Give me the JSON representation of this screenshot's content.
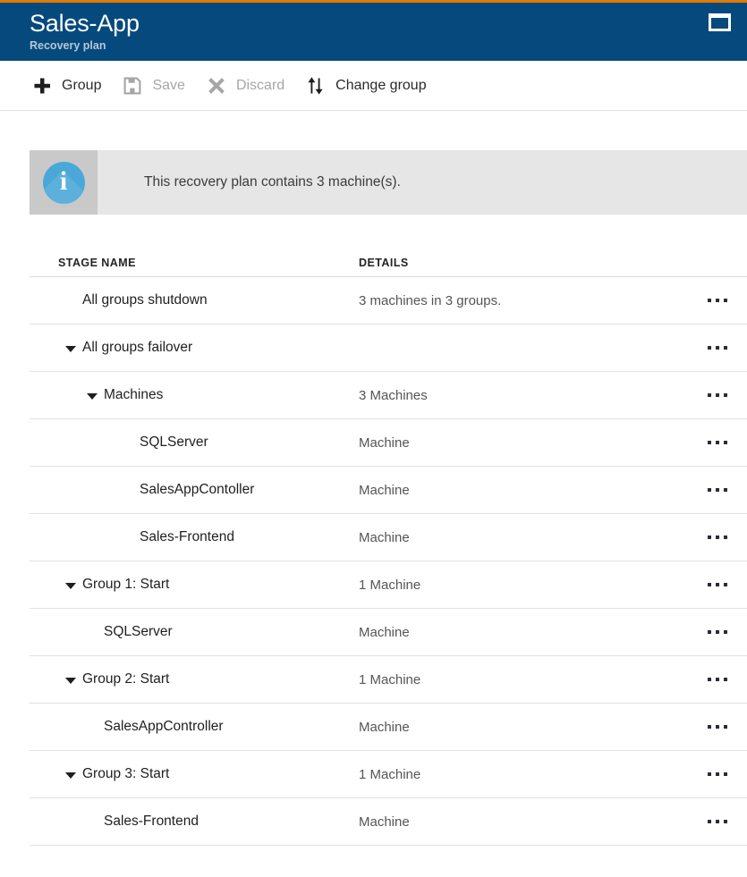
{
  "header": {
    "title": "Sales-App",
    "subtitle": "Recovery plan",
    "maximize_icon": "maximize-icon",
    "background_color": "#064a7d",
    "accent_color": "#e07b00"
  },
  "toolbar": {
    "commands": [
      {
        "label": "Group",
        "icon": "plus-icon",
        "enabled": true
      },
      {
        "label": "Save",
        "icon": "save-floppy-icon",
        "enabled": false
      },
      {
        "label": "Discard",
        "icon": "cross-icon",
        "enabled": false
      },
      {
        "label": "Change group",
        "icon": "sort-arrows-icon",
        "enabled": true
      }
    ]
  },
  "info_banner": {
    "icon": "info-icon",
    "icon_letter": "i",
    "message": "This recovery plan contains 3 machine(s).",
    "icon_color": "#4aa8d8",
    "background_color": "#e6e6e6"
  },
  "grid": {
    "columns": {
      "stage_name": "STAGE NAME",
      "details": "DETAILS"
    },
    "row_menu_icon": "ellipsis-icon",
    "rows": [
      {
        "name": "All groups shutdown",
        "details": "3 machines in 3 groups.",
        "indent": 1,
        "expandable": false,
        "expanded": false
      },
      {
        "name": "All groups failover",
        "details": "",
        "indent": 1,
        "expandable": true,
        "expanded": true
      },
      {
        "name": "Machines",
        "details": "3 Machines",
        "indent": 2,
        "expandable": true,
        "expanded": true
      },
      {
        "name": "SQLServer",
        "details": "Machine",
        "indent": 3,
        "expandable": false,
        "expanded": false
      },
      {
        "name": "SalesAppContoller",
        "details": "Machine",
        "indent": 3,
        "expandable": false,
        "expanded": false
      },
      {
        "name": "Sales-Frontend",
        "details": "Machine",
        "indent": 3,
        "expandable": false,
        "expanded": false
      },
      {
        "name": "Group 1: Start",
        "details": "1 Machine",
        "indent": 1,
        "expandable": true,
        "expanded": true
      },
      {
        "name": "SQLServer",
        "details": "Machine",
        "indent": 2,
        "expandable": false,
        "expanded": false
      },
      {
        "name": "Group 2: Start",
        "details": "1 Machine",
        "indent": 1,
        "expandable": true,
        "expanded": true
      },
      {
        "name": "SalesAppController",
        "details": "Machine",
        "indent": 2,
        "expandable": false,
        "expanded": false
      },
      {
        "name": "Group 3: Start",
        "details": "1 Machine",
        "indent": 1,
        "expandable": true,
        "expanded": true
      },
      {
        "name": "Sales-Frontend",
        "details": "Machine",
        "indent": 2,
        "expandable": false,
        "expanded": false
      }
    ]
  }
}
